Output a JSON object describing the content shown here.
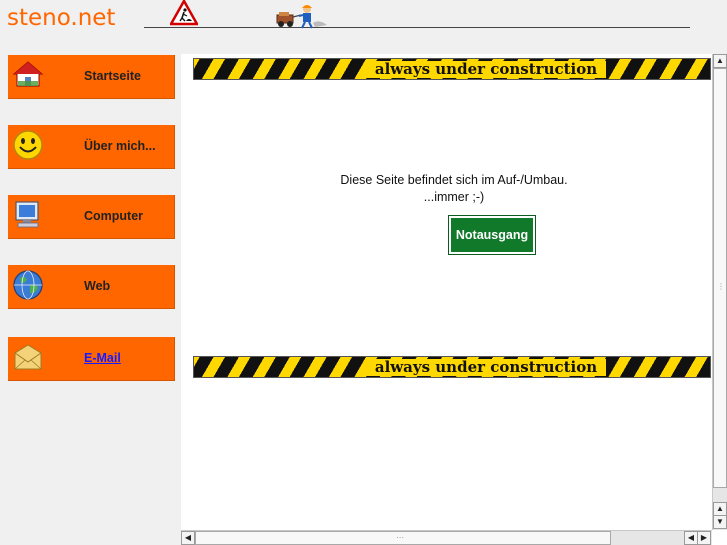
{
  "header": {
    "logo_text": "steno.net",
    "icons": [
      "roadwork-sign-icon",
      "construction-worker-icon"
    ]
  },
  "sidebar": {
    "items": [
      {
        "label": "Startseite",
        "icon": "house-icon"
      },
      {
        "label": "Über mich...",
        "icon": "smiley-icon"
      },
      {
        "label": "Computer",
        "icon": "computer-icon"
      },
      {
        "label": "Web",
        "icon": "globe-icon"
      },
      {
        "label": "E-Mail",
        "icon": "envelope-icon"
      }
    ]
  },
  "main": {
    "banner_top": "always under construction",
    "message_line1": "Diese Seite befindet sich im Auf-/Umbau.",
    "message_line2": "...immer ;-)",
    "exit_button": "Notausgang",
    "banner_bottom": "always under construction"
  },
  "colors": {
    "accent": "#ff6600",
    "exit_green": "#117a2a",
    "stripe_yellow": "#ffd800",
    "link_blue": "#1a1aff"
  }
}
